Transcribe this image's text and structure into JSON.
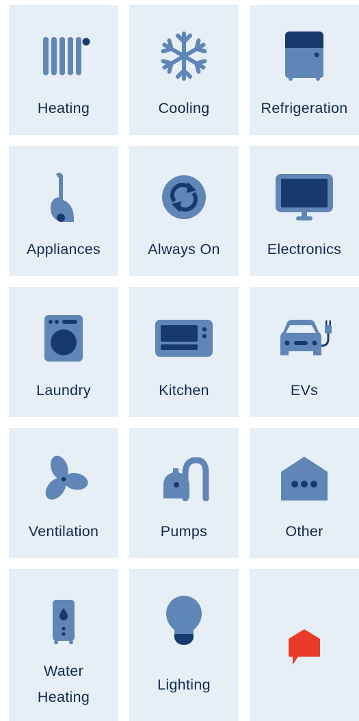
{
  "colors": {
    "tile_bg": "#e6eef6",
    "icon_light": "#5f86b7",
    "icon_dark": "#163a6b",
    "text": "#0f2a4d",
    "brand": "#ea3a2a"
  },
  "tiles": [
    {
      "label": "Heating",
      "icon": "radiator-icon"
    },
    {
      "label": "Cooling",
      "icon": "snowflake-icon"
    },
    {
      "label": "Refrigeration",
      "icon": "refrigerator-icon"
    },
    {
      "label": "Appliances",
      "icon": "vacuum-icon"
    },
    {
      "label": "Always On",
      "icon": "cycle-icon"
    },
    {
      "label": "Electronics",
      "icon": "monitor-icon"
    },
    {
      "label": "Laundry",
      "icon": "washing-machine-icon"
    },
    {
      "label": "Kitchen",
      "icon": "microwave-icon"
    },
    {
      "label": "EVs",
      "icon": "electric-car-icon"
    },
    {
      "label": "Ventilation",
      "icon": "fan-icon"
    },
    {
      "label": "Pumps",
      "icon": "pump-icon"
    },
    {
      "label": "Other",
      "icon": "house-dots-icon"
    },
    {
      "label_line1": "Water",
      "label_line2": "Heating",
      "icon": "water-heater-icon"
    },
    {
      "label": "Lighting",
      "icon": "lightbulb-icon"
    },
    {
      "label": "",
      "icon": "brand-logo-icon"
    }
  ]
}
